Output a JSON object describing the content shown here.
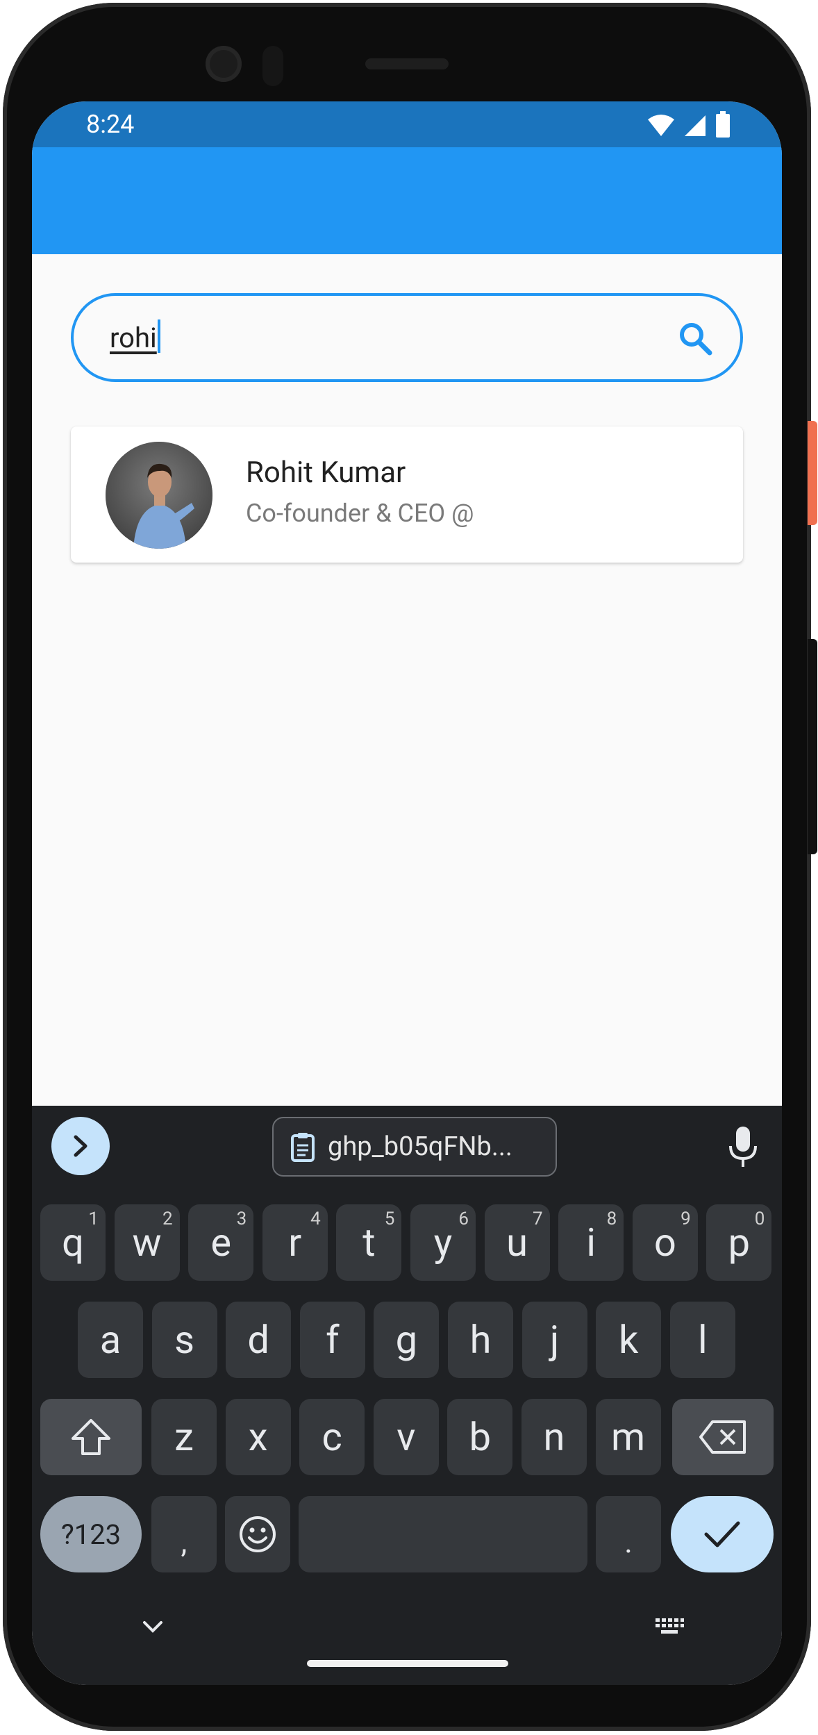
{
  "status_bar": {
    "time": "8:24",
    "icons": [
      "wifi-icon",
      "cellular-signal-icon",
      "battery-icon"
    ]
  },
  "app_bar": {
    "title": ""
  },
  "search": {
    "value": "rohi",
    "icon": "search-icon"
  },
  "results": [
    {
      "name": "Rohit Kumar",
      "subtitle": "Co-founder & CEO @",
      "avatar": "avatar-photo"
    }
  ],
  "keyboard": {
    "clipboard_suggestion": "ghp_b05qFNb...",
    "row1": [
      {
        "label": "q",
        "hint": "1"
      },
      {
        "label": "w",
        "hint": "2"
      },
      {
        "label": "e",
        "hint": "3"
      },
      {
        "label": "r",
        "hint": "4"
      },
      {
        "label": "t",
        "hint": "5"
      },
      {
        "label": "y",
        "hint": "6"
      },
      {
        "label": "u",
        "hint": "7"
      },
      {
        "label": "i",
        "hint": "8"
      },
      {
        "label": "o",
        "hint": "9"
      },
      {
        "label": "p",
        "hint": "0"
      }
    ],
    "row2": [
      "a",
      "s",
      "d",
      "f",
      "g",
      "h",
      "j",
      "k",
      "l"
    ],
    "row3": [
      "z",
      "x",
      "c",
      "v",
      "b",
      "n",
      "m"
    ],
    "symbols_label": "?123",
    "comma_label": ",",
    "period_label": "."
  },
  "colors": {
    "status_bar": "#1b74bd",
    "app_bar": "#2196f3",
    "accent": "#2196f3",
    "keyboard_bg": "#1f2124",
    "key_bg": "#35383c",
    "action_key": "#c5e3fb"
  }
}
